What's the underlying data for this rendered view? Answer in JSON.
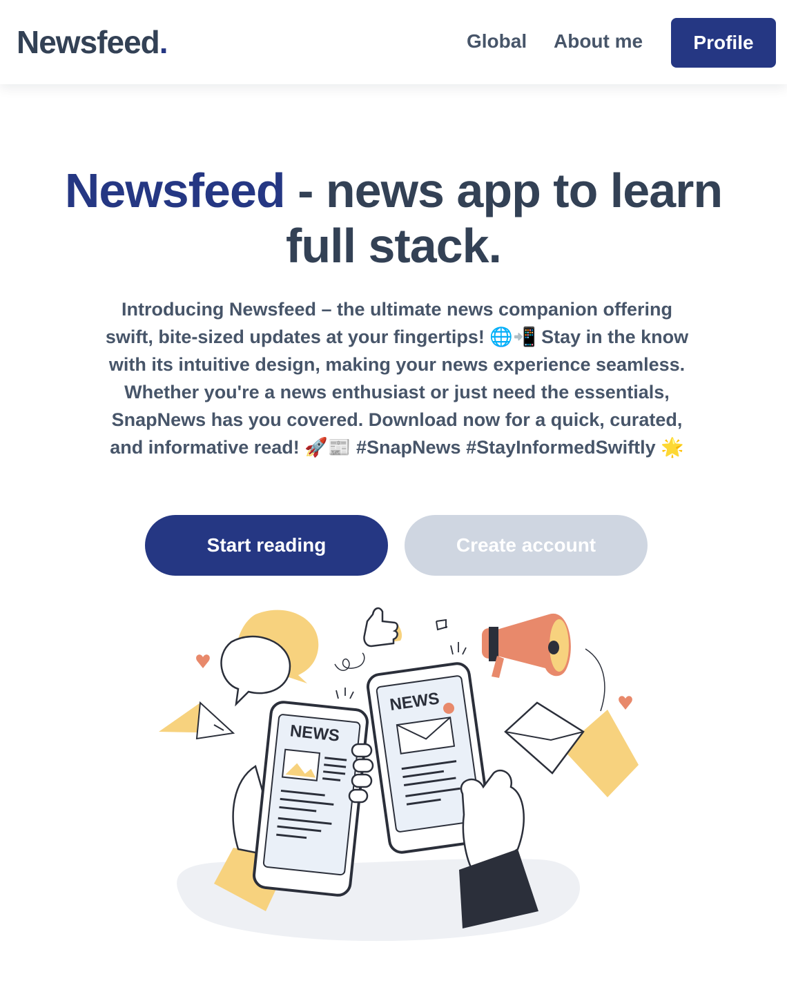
{
  "navbar": {
    "brand": "Newsfeed",
    "brand_dot": ".",
    "links": [
      {
        "label": "Global"
      },
      {
        "label": "About me"
      }
    ],
    "profile_label": "Profile"
  },
  "hero": {
    "title_accent": "Newsfeed",
    "title_rest": " - news app to learn full stack.",
    "description": "Introducing Newsfeed – the ultimate news companion offering swift, bite-sized updates at your fingertips! 🌐📲 Stay in the know with its intuitive design, making your news experience seamless. Whether you're a news enthusiast or just need the essentials, SnapNews has you covered. Download now for a quick, curated, and informative read! 🚀📰 #SnapNews #StayInformedSwiftly 🌟",
    "primary_button": "Start reading",
    "secondary_button": "Create account"
  },
  "illustration": {
    "phone_left_label": "NEWS",
    "phone_right_label": "NEWS"
  },
  "colors": {
    "brand": "#253783",
    "text": "#334155",
    "secondary_button": "#cfd6e1",
    "accent_yellow": "#f7d27e",
    "accent_coral": "#e8896b"
  }
}
